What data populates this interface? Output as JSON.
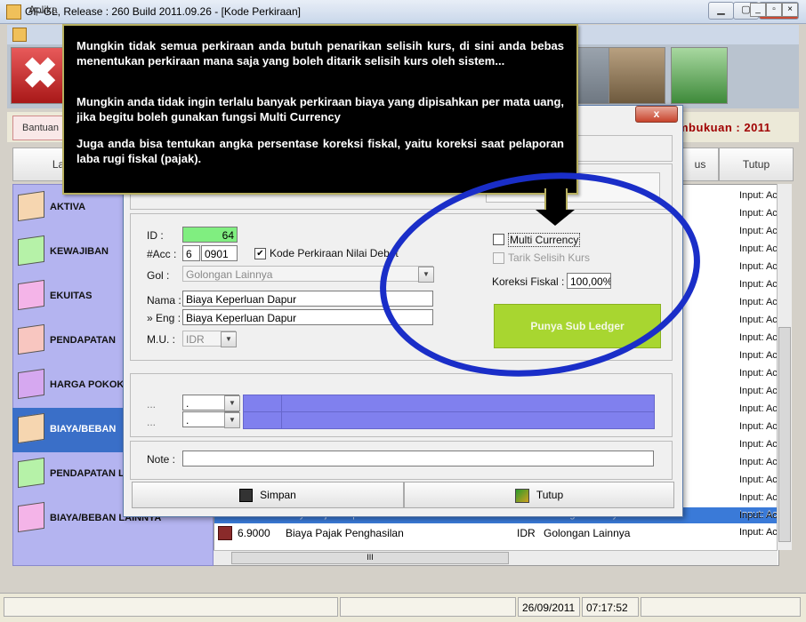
{
  "window": {
    "title": "GF-GL, Release : 260 Build 2011.09.26 - [Kode Perkiraan]"
  },
  "mdi": {
    "title": "Aplika"
  },
  "menubar": {
    "bantuan": "Bantuan",
    "laporan": "Lapora",
    "hapus": "us",
    "tutup": "Tutup",
    "year": "mbukuan : 2011"
  },
  "toolbar": {
    "exit_glyph": "✖"
  },
  "categories": [
    {
      "label": "AKTIVA",
      "color": "#f6d6b0"
    },
    {
      "label": "KEWAJIBAN",
      "color": "#b6f2a8"
    },
    {
      "label": "EKUITAS",
      "color": "#f4b4e8"
    },
    {
      "label": "PENDAPATAN",
      "color": "#f8c6c0"
    },
    {
      "label": "HARGA POKOK",
      "color": "#d6a8f0"
    },
    {
      "label": "BIAYA/BEBAN",
      "color": "#f6d6b0"
    },
    {
      "label": "PENDAPATAN L",
      "color": "#b6f2a8"
    },
    {
      "label": "BIAYA/BEBAN LAINNYA",
      "color": "#f4b4e8"
    }
  ],
  "list": {
    "input_col": [
      "Input: Ac",
      "Input: Ac",
      "Input: Ac",
      "Input: Ac",
      "Input: Ac",
      "Input: Ac",
      "Input: Ac",
      "Input: Ac",
      "Input: Ac",
      "Input: Ac",
      "Input: Ac",
      "Input: Ac",
      "Input: Ac",
      "Input: Ac",
      "Input: Ac",
      "Input: Ac",
      "Input: Ac",
      "Input: Ac",
      "Input: Ac"
    ],
    "row_last": {
      "code": "6.9000",
      "name": "Biaya Pajak Penghasilan",
      "mu": "IDR",
      "gol": "Golongan Lainnya",
      "input": "Input: Ac"
    },
    "row_sel_partial": {
      "name": "Biaya Pajak Dapur",
      "mu": "IDR",
      "gol": "Golongan Lainnya",
      "input": "Input: Ac"
    },
    "hscroll_grip": "III"
  },
  "status": {
    "date": "26/09/2011",
    "time": "07:17:52"
  },
  "dialog": {
    "close_label": "x",
    "id_label": "ID :",
    "id_value": "64",
    "acc_label": "#Acc :",
    "acc_prefix": "6",
    "acc_value": "0901",
    "debet_label": "Kode Perkiraan Nilai Debet",
    "debet_check": "✔",
    "gol_label": "Gol :",
    "gol_value": "Golongan Lainnya",
    "nama_label": "Nama :",
    "nama_value": "Biaya Keperluan Dapur",
    "eng_label": "» Eng :",
    "eng_value": "Biaya Keperluan Dapur",
    "mu_label": "M.U. :",
    "mu_value": "IDR",
    "multi_currency_label": "Multi Currency",
    "tarik_label": "Tarik Selisih Kurs",
    "koreksi_label": "Koreksi Fiskal :",
    "koreksi_value": "100,00%",
    "subledger_label": "Punya Sub Ledger",
    "dots1": "...",
    "dots2": "...",
    "dd1_value": ".",
    "dd2_value": ".",
    "note_label": "Note :",
    "note_value": "",
    "simpan_label": "Simpan",
    "tutup_label": "Tutup"
  },
  "tooltip": {
    "p1": "Mungkin tidak semua perkiraan anda butuh penarikan selisih kurs, di sini anda bebas menentukan perkiraan mana saja yang boleh ditarik selisih kurs oleh sistem...",
    "p2": "Mungkin anda tidak ingin terlalu banyak perkiraan biaya yang dipisahkan per mata uang, jika begitu boleh gunakan fungsi Multi Currency",
    "p3": "Juga anda bisa tentukan angka persentase koreksi fiskal, yaitu koreksi saat pelaporan laba rugi fiskal (pajak)."
  }
}
